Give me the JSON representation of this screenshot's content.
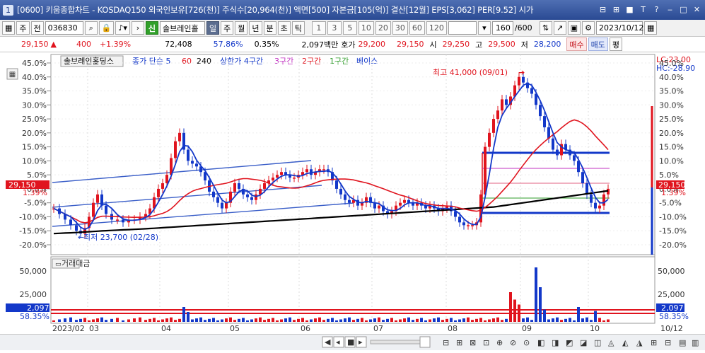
{
  "title": {
    "num": "1",
    "text": "[0600] 키움종합차트 - KOSDAQ150 외국인보유[726(천)] 주식수[20,964(천)] 액면[500] 자본금[105(억)] 결산[12월] EPS[3,062] PER[9.52] 시가",
    "controls": [
      "⊟",
      "⊞",
      "■",
      "T",
      "?",
      "‒",
      "□",
      "✕"
    ]
  },
  "toolbar": {
    "market": "주",
    "prev": "전",
    "code": "036830",
    "search_icon": "search-icon",
    "badge": "신",
    "stock_name": "솔브레인홀",
    "periods": [
      "일",
      "주",
      "월",
      "년",
      "분",
      "초",
      "틱"
    ],
    "active_period": "일",
    "intervals": [
      "1",
      "3",
      "5",
      "10",
      "20",
      "30",
      "60",
      "120"
    ],
    "count": "160",
    "count_total": "/600",
    "date": "2023/10/12"
  },
  "price": {
    "current": "29,150",
    "change": "400",
    "change_pct": "+1.39%",
    "volume": "72,408",
    "vol_pct": "57.86%",
    "turnover": "0.35%",
    "amount": "2,097백만",
    "quote_label": "호가",
    "quote": "29,200",
    "quote2": "29,150",
    "open_label": "시",
    "open": "29,250",
    "high_label": "고",
    "high": "29,500",
    "low_label": "저",
    "low": "28,200",
    "buy": "매수",
    "sell": "매도",
    "eval": "평"
  },
  "chart": {
    "legend_name": "솔브레인홀딩스",
    "legend_ma": "종가 단순 5",
    "legend_60": "60",
    "legend_240": "240",
    "legend_upper": "상한가 4구간",
    "legend_3": "3구간",
    "legend_2": "2구간",
    "legend_1": "1구간",
    "legend_base": "베이스",
    "lc_label": "LC:23.00",
    "hc_label": "HC:-28.90",
    "left_ticks": [
      "45.0%",
      "40.0%",
      "35.0%",
      "30.0%",
      "25.0%",
      "20.0%",
      "15.0%",
      "10.0%",
      "5.0%",
      "0.0%",
      "-5.0%",
      "-10.0%",
      "-15.0%",
      "-20.0%"
    ],
    "right_ticks": [
      "45.0%",
      "40.0%",
      "35.0%",
      "30.0%",
      "25.0%",
      "20.0%",
      "15.0%",
      "10.0%",
      "5.0%",
      "0.0%",
      "-5.0%",
      "-10.0%",
      "-15.0%",
      "-20.0%"
    ],
    "price_tag": "29,150",
    "price_pct": "1.39%",
    "high_note": "최고 41,000 (09/01)",
    "low_note": "최저 23,700 (02/28)",
    "vol_title": "거래대금",
    "vol_ticks": [
      "50,000",
      "25,000"
    ],
    "vol_tag": "2,097",
    "vol_pct": "58.35%",
    "x_labels": [
      "2023/02",
      "03",
      "04",
      "05",
      "06",
      "07",
      "08",
      "09",
      "10"
    ],
    "right_date": "10/12"
  },
  "colors": {
    "up": "#e0141e",
    "down": "#1338c9",
    "ma60": "#e0141e",
    "ma240": "#000000"
  }
}
